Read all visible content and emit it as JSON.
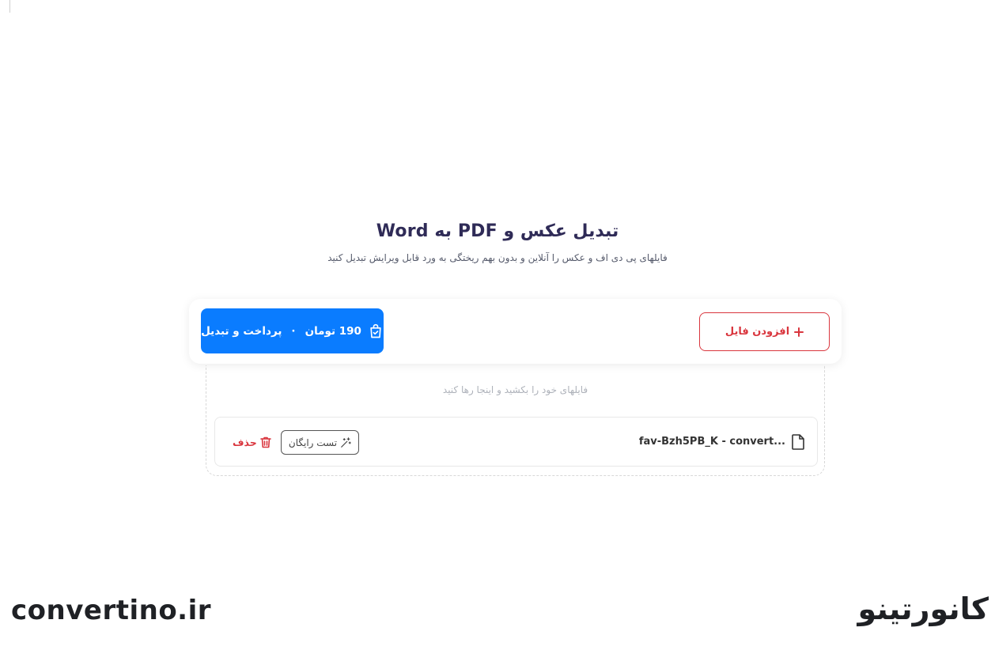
{
  "hero": {
    "title": "تبدیل عکس و PDF به Word",
    "subtitle": "فایلهای پی دی اف و عکس را آنلاین و بدون بهم ریختگی به ورد قابل ویرایش تبدیل کنید"
  },
  "actions": {
    "pay_price": "190 تومان",
    "pay_separator": "·",
    "pay_label": "پرداخت و تبدیل",
    "add_file_label": "افزودن فایل"
  },
  "dropzone": {
    "hint": "فایلهای خود را بکشید و اینجا رها کنید"
  },
  "files": [
    {
      "name": "fav-Bzh5PB_K - convert...",
      "free_test_label": "تست رایگان",
      "delete_label": "حذف"
    }
  ],
  "watermark": {
    "latin": "convertino.ir",
    "persian": "کانورتینو"
  },
  "colors": {
    "primary": "#0a7cff",
    "danger": "#d9363e",
    "title": "#2f2b57"
  },
  "icons": {
    "pay": "shopping-bag-check-icon",
    "add": "plus-icon",
    "file": "file-icon",
    "free_test": "magic-wand-icon",
    "delete": "trash-icon"
  }
}
